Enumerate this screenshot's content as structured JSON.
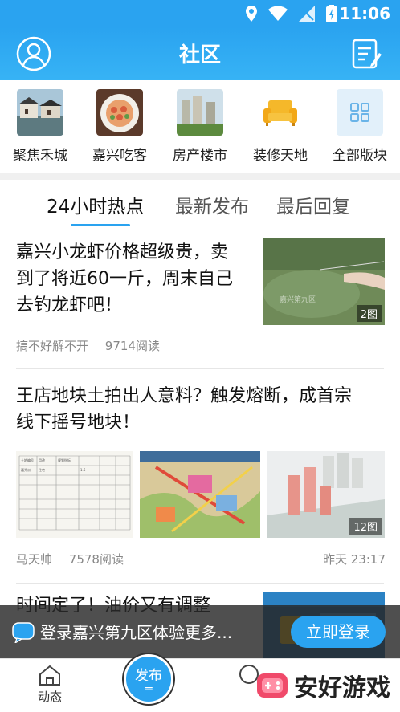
{
  "status_bar": {
    "time": "11:06"
  },
  "header": {
    "title": "社区"
  },
  "boards": [
    {
      "label": "聚焦禾城",
      "icon": "town-photo"
    },
    {
      "label": "嘉兴吃客",
      "icon": "food-photo"
    },
    {
      "label": "房产楼市",
      "icon": "building-photo"
    },
    {
      "label": "装修天地",
      "icon": "sofa-icon"
    },
    {
      "label": "全部版块",
      "icon": "grid-icon"
    }
  ],
  "tabs": [
    {
      "label": "24小时热点",
      "active": true
    },
    {
      "label": "最新发布",
      "active": false
    },
    {
      "label": "最后回复",
      "active": false
    }
  ],
  "posts": [
    {
      "title_lines": [
        "嘉兴小龙虾价格超级贵，卖",
        "到了将近60一斤，周末自己",
        "去钓龙虾吧！"
      ],
      "author": "搞不好解不开",
      "reads": "9714阅读",
      "time": "",
      "image_count": "2图"
    },
    {
      "title_lines": [
        "王店地块土拍出人意料？触发熔断，成首宗",
        "线下摇号地块！"
      ],
      "author": "马天帅",
      "reads": "7578阅读",
      "time": "昨天 23:17",
      "image_count": "12图"
    },
    {
      "title_lines": [
        "时间定了！油价又有调整"
      ],
      "author": "",
      "reads": "",
      "time": "",
      "image_count": ""
    }
  ],
  "login_banner": {
    "message": "登录嘉兴第九区体验更多...",
    "button": "立即登录"
  },
  "bottom_nav": {
    "dynamic": "动态",
    "publish": "发布"
  },
  "watermark": {
    "text": "安好游戏"
  },
  "colors": {
    "accent": "#2aa3f0",
    "banner_bg": "#282828"
  }
}
